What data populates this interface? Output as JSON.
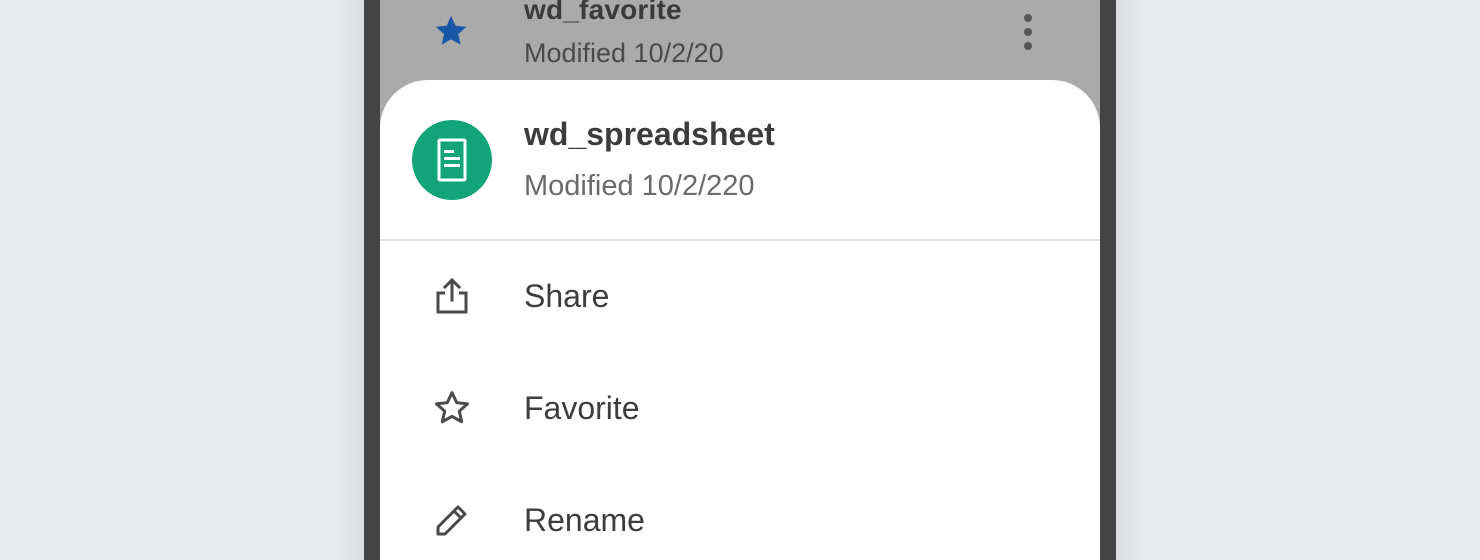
{
  "background_row": {
    "name": "wd_favorite",
    "meta": "Modified 10/2/20",
    "icon": "star-filled-icon",
    "more_icon": "more-vert-icon"
  },
  "sheet": {
    "file": {
      "name": "wd_spreadsheet",
      "meta": "Modified 10/2/220",
      "icon": "document-icon"
    },
    "menu": [
      {
        "label": "Share",
        "icon": "share-icon"
      },
      {
        "label": "Favorite",
        "icon": "star-outline-icon"
      },
      {
        "label": "Rename",
        "icon": "pencil-icon"
      }
    ]
  },
  "colors": {
    "accent_star": "#1a56a8",
    "file_icon_bg": "#12a57a",
    "scrim": "#aaaaaa",
    "phone_frame": "#444444"
  }
}
